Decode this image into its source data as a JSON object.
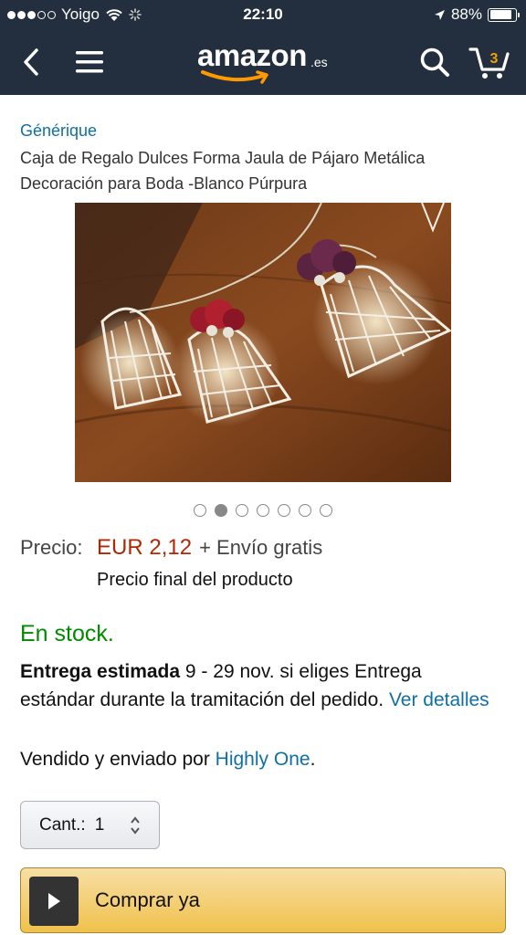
{
  "status_bar": {
    "carrier": "Yoigo",
    "time": "22:10",
    "battery": "88%",
    "battery_level": 0.88
  },
  "nav": {
    "logo_word": "amazon",
    "logo_tld": ".es",
    "cart_count": "3",
    "icons": [
      "back-icon",
      "menu-icon",
      "search-icon",
      "cart-icon"
    ]
  },
  "product": {
    "brand": "Générique",
    "title": "Caja de Regalo Dulces Forma Jaula de Pájaro Metálica Decoración para Boda -Blanco Púrpura"
  },
  "carousel": {
    "total": 7,
    "active_index": 1
  },
  "price": {
    "label": "Precio:",
    "value": "EUR 2,12",
    "shipping": "+ Envío gratis",
    "note": "Precio final del producto"
  },
  "availability": "En stock.",
  "delivery": {
    "bold": "Entrega estimada",
    "text": "9 - 29 nov. si eliges Entrega estándar durante la tramitación del pedido.",
    "link": "Ver detalles"
  },
  "seller": {
    "prefix": "Vendido y enviado por",
    "name": "Highly One",
    "suffix": "."
  },
  "quantity": {
    "label": "Cant.:",
    "value": "1"
  },
  "buy_button": {
    "label": "Comprar ya"
  },
  "colors": {
    "header_bg": "#232f3e",
    "link": "#0f6fa6",
    "price": "#b12704",
    "in_stock": "#008a00",
    "buy_button": "#f0c14b"
  }
}
